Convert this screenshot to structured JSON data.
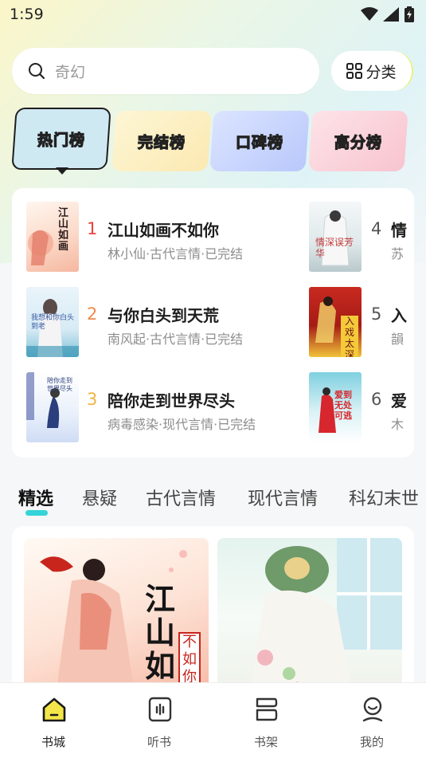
{
  "status": {
    "time": "1:59"
  },
  "search": {
    "placeholder": "奇幻"
  },
  "category_button": {
    "label": "分类"
  },
  "rank_tabs": [
    {
      "label": "热门榜",
      "active": true
    },
    {
      "label": "完结榜",
      "active": false
    },
    {
      "label": "口碑榜",
      "active": false
    },
    {
      "label": "高分榜",
      "active": false
    }
  ],
  "ranking": [
    {
      "rank": "1",
      "title": "江山如画不如你",
      "meta": "林小仙·古代言情·已完结",
      "cover_text": "江山如画"
    },
    {
      "rank": "2",
      "title": "与你白头到天荒",
      "meta": "南风起·古代言情·已完结",
      "cover_text": "我想和你白头到老"
    },
    {
      "rank": "3",
      "title": "陪你走到世界尽头",
      "meta": "病毒感染·现代言情·已完结",
      "cover_text": "陪你走到世界尽头"
    },
    {
      "rank": "4",
      "title": "情",
      "meta": "苏",
      "cover_text": "情深误芳华"
    },
    {
      "rank": "5",
      "title": "入",
      "meta": "韻",
      "cover_text": "入戏太深"
    },
    {
      "rank": "6",
      "title": "爱",
      "meta": "木",
      "cover_text": "爱到无处可逃"
    }
  ],
  "genre_tabs": [
    {
      "label": "精选",
      "active": true
    },
    {
      "label": "悬疑",
      "active": false
    },
    {
      "label": "古代言情",
      "active": false
    },
    {
      "label": "现代言情",
      "active": false
    },
    {
      "label": "科幻末世",
      "active": false
    }
  ],
  "featured": [
    {
      "cover_text_1": "江山如",
      "cover_text_2": "不如你"
    },
    {
      "cover_text_1": ""
    }
  ],
  "bottom_nav": [
    {
      "label": "书城",
      "icon": "home-icon",
      "active": true
    },
    {
      "label": "听书",
      "icon": "audio-icon",
      "active": false
    },
    {
      "label": "书架",
      "icon": "bookshelf-icon",
      "active": false
    },
    {
      "label": "我的",
      "icon": "profile-icon",
      "active": false
    }
  ],
  "colors": {
    "accent": "#34d4d8",
    "rank_1": "#e8433d",
    "rank_2": "#f08a4b",
    "rank_3": "#f2b440",
    "rank_other": "#555555"
  }
}
